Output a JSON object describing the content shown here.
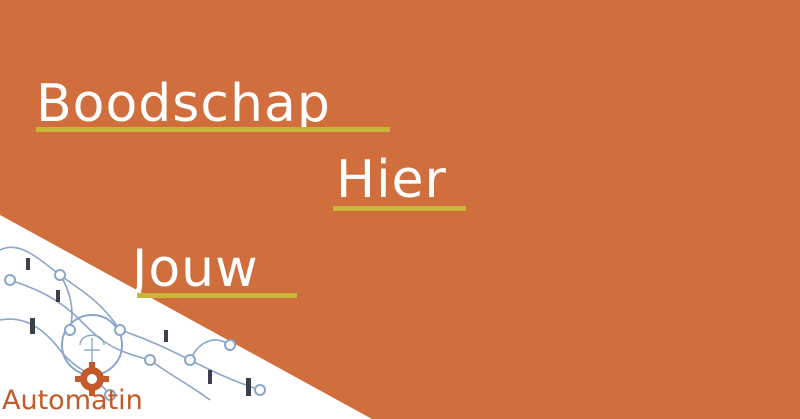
{
  "banner": {
    "words": [
      "Boodschap",
      "Hier",
      "Jouw"
    ],
    "brand_name": "Automatin"
  },
  "colors": {
    "background": "#d06e3e",
    "text": "#ffffff",
    "underline": "#c9b53a",
    "corner_panel": "#ffffff",
    "network_lines": "#8aa6c8",
    "brand_text": "#c25a2a"
  },
  "icons": [
    "network-illustration",
    "gear-logo-icon",
    "brain-circuit-icon"
  ]
}
